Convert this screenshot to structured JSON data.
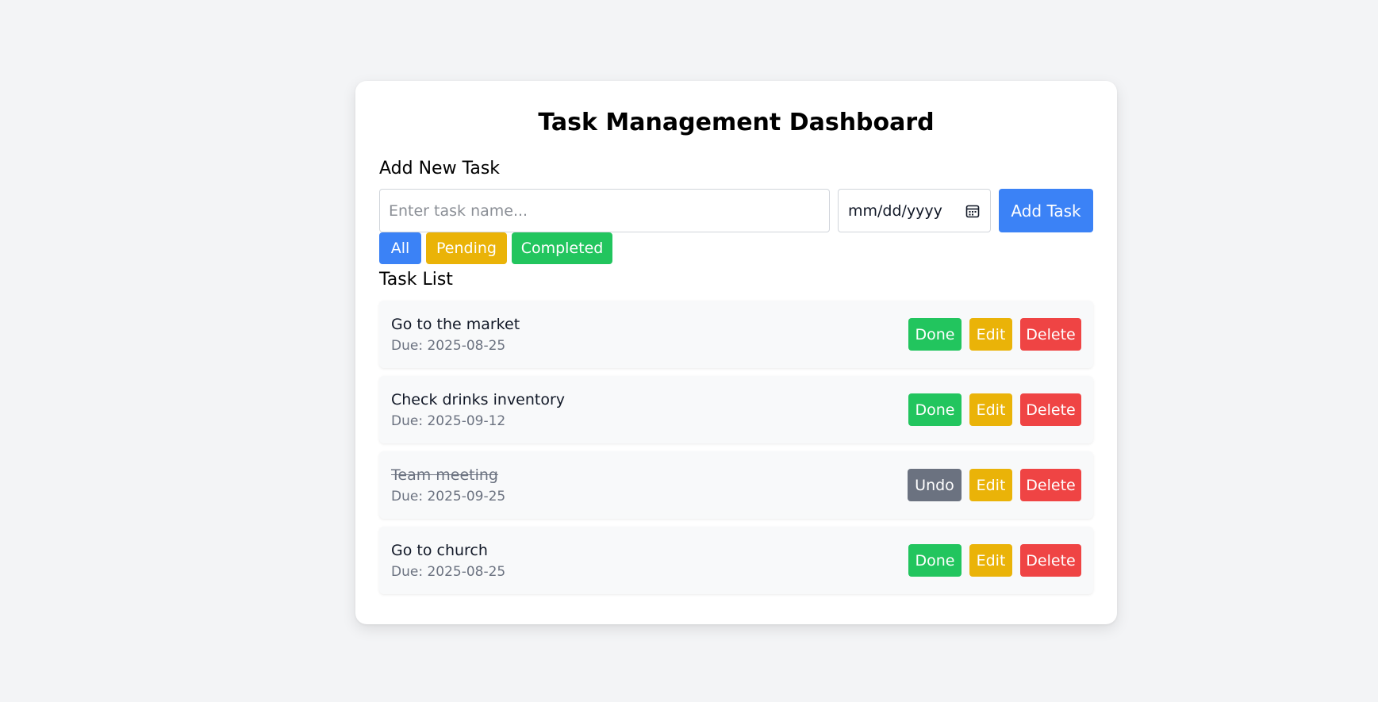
{
  "app": {
    "title": "Task Management Dashboard"
  },
  "add_form": {
    "heading": "Add New Task",
    "task_placeholder": "Enter task name...",
    "date_placeholder": "mm/dd/yyyy",
    "add_label": "Add Task"
  },
  "filters": {
    "all": "All",
    "pending": "Pending",
    "completed": "Completed"
  },
  "task_list": {
    "heading": "Task List",
    "tasks": [
      {
        "name": "Go to the market",
        "due": "Due: 2025-08-25",
        "completed": false,
        "toggle_label": "Done",
        "edit_label": "Edit",
        "delete_label": "Delete"
      },
      {
        "name": "Check drinks inventory",
        "due": "Due: 2025-09-12",
        "completed": false,
        "toggle_label": "Done",
        "edit_label": "Edit",
        "delete_label": "Delete"
      },
      {
        "name": "Team meeting",
        "due": "Due: 2025-09-25",
        "completed": true,
        "toggle_label": "Undo",
        "edit_label": "Edit",
        "delete_label": "Delete"
      },
      {
        "name": "Go to church",
        "due": "Due: 2025-08-25",
        "completed": false,
        "toggle_label": "Done",
        "edit_label": "Edit",
        "delete_label": "Delete"
      }
    ]
  },
  "icons": {
    "date_picker": "calendar-icon"
  },
  "colors": {
    "primary": "#3b82f6",
    "warning": "#eab308",
    "success": "#22c55e",
    "danger": "#ef4444",
    "muted": "#6b7280",
    "background": "#f3f4f6"
  }
}
